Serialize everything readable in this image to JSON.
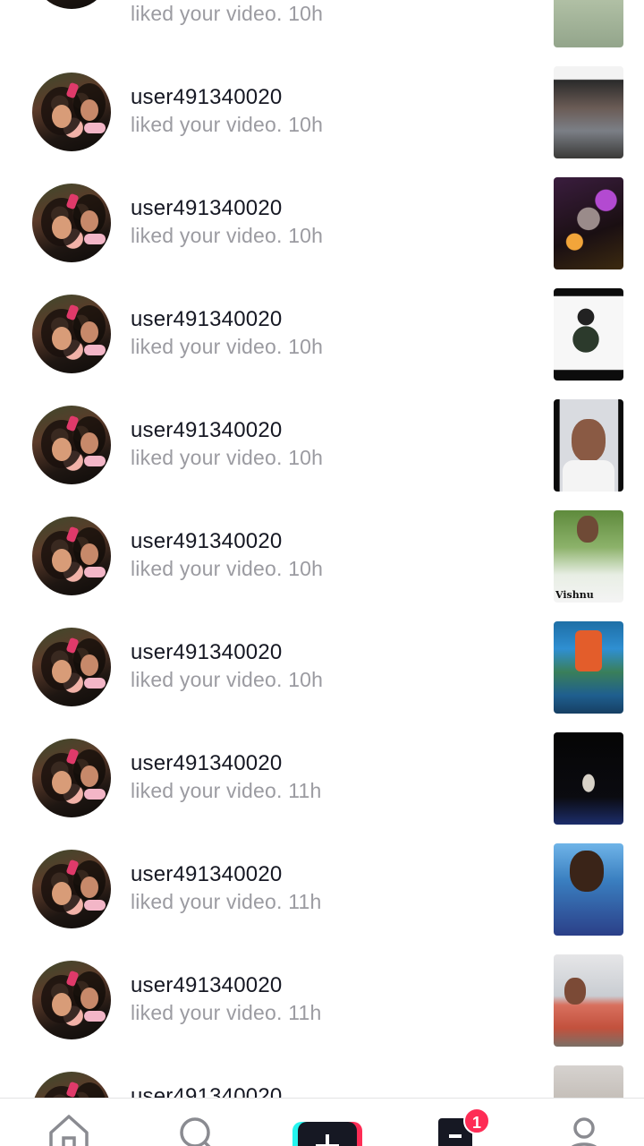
{
  "notifications": [
    {
      "username": "",
      "action": "liked your video. 10h"
    },
    {
      "username": "user491340020",
      "action": "liked your video. 10h"
    },
    {
      "username": "user491340020",
      "action": "liked your video. 10h"
    },
    {
      "username": "user491340020",
      "action": "liked your video. 10h"
    },
    {
      "username": "user491340020",
      "action": "liked your video. 10h"
    },
    {
      "username": "user491340020",
      "action": "liked your video. 10h"
    },
    {
      "username": "user491340020",
      "action": "liked your video. 10h"
    },
    {
      "username": "user491340020",
      "action": "liked your video. 11h"
    },
    {
      "username": "user491340020",
      "action": "liked your video. 11h"
    },
    {
      "username": "user491340020",
      "action": "liked your video. 11h"
    },
    {
      "username": "user491340020",
      "action": ""
    }
  ],
  "thumbnail_captions": {
    "vishnu": "Vishnu"
  },
  "nav": {
    "items": [
      "home-icon",
      "search-icon",
      "create-plus-icon",
      "inbox-icon",
      "profile-icon"
    ],
    "inbox_badge": "1"
  },
  "colors": {
    "accent_red": "#fe2c55",
    "accent_cyan": "#25f4ee",
    "text_primary": "#161823",
    "text_secondary": "#9b9ba1"
  }
}
